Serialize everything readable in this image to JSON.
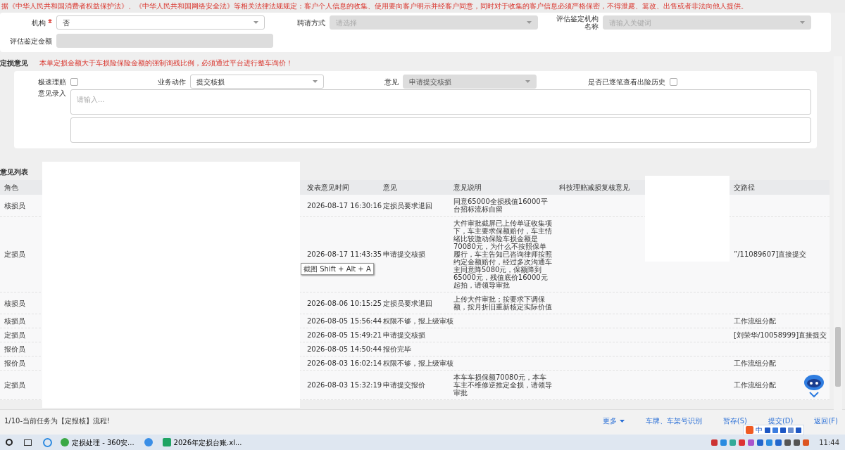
{
  "banner": "据《中华人民共和国消费者权益保护法》、《中华人民共和国网络安全法》等相关法律法规规定：客户个人信息的收集、使用要向客户明示并经客户同意，同时对于收集的客户信息必须严格保密，不得泄露、篡改、出售或者非法向他人提供。",
  "top_form": [
    {
      "kind": "select",
      "label": "机构",
      "required": true,
      "value": "否",
      "disabled": false
    },
    {
      "kind": "select",
      "label": "聘请方式",
      "required": false,
      "placeholder": "请选择",
      "disabled": true
    },
    {
      "kind": "select",
      "label": "评估鉴定机构名称",
      "required": false,
      "placeholder": "请输入关键词",
      "disabled": true
    },
    {
      "kind": "input",
      "label": "评估鉴定金额",
      "required": false,
      "disabled": true
    }
  ],
  "opinion": {
    "title": "定损意见",
    "warning": "本单定损金额大于车损险保险金额的强制询残比例，必须通过平台进行整车询价！",
    "fields": [
      {
        "kind": "checkbox",
        "label": "极速理赔",
        "checked": false
      },
      {
        "kind": "select",
        "label": "业务动作",
        "value": "提交核损",
        "disabled": false
      },
      {
        "kind": "select",
        "label": "意见",
        "value": "申请提交核损",
        "disabled": true
      },
      {
        "kind": "checkbox",
        "label": "是否已逐笔查看出险历史",
        "checked": false
      }
    ],
    "entry_label": "意见录入",
    "entry_placeholder": "请输入..."
  },
  "table": {
    "title": "意见列表",
    "columns": [
      "角色",
      "发表意见时间",
      "意见",
      "意见说明",
      "科技理赔减损复核意见",
      "交路径"
    ],
    "rows": [
      {
        "role": "核损员",
        "time": "2026-08-17 16:30:16",
        "opinion": "定损员要求退回",
        "note": "同意65000全损残值16000平台招标流标自留"
      },
      {
        "role": "定损员",
        "time": "2026-08-17 11:43:35",
        "opinion": "申请提交核损",
        "note": "大件审批截屏已上传单证收集项下，车主要求保额赔付，车主情绪比较激动保险车损金额是70080元，为什么不按照保单履行，车主告知已咨询律师按照约定金额赔付，经过多次沟通车主同意降5080元，保额降到65000元，残值底价16000元起拍，请领导审批",
        "route": "”/11089607]直接提交"
      },
      {
        "role": "核损员",
        "time": "2026-08-06 10:15:25",
        "opinion": "定损员要求退回",
        "note": "上传大件审批；按要求下调保额，按月折旧重新核定实际价值"
      },
      {
        "role": "核损员",
        "time": "2026-08-05 15:56:44",
        "opinion": "权限不够，报上级审核",
        "route": "工作流组分配"
      },
      {
        "role": "定损员",
        "time": "2026-08-05 15:49:21",
        "opinion": "申请提交核损",
        "route": "[刘荣华/10058999]直接提交"
      },
      {
        "role": "报价员",
        "time": "2026-08-05 14:50:44",
        "opinion": "报价完毕"
      },
      {
        "role": "报价员",
        "time": "2026-08-03 16:02:14",
        "opinion": "权限不够，报上级审核",
        "route": "工作流组分配"
      },
      {
        "role": "定损员",
        "time": "2026-08-03 15:32:19",
        "opinion": "申请提交报价",
        "note": "本车车损保额70080元，本车车主不维修逆推定全损，请领导审批",
        "route": "工作流组分配"
      }
    ]
  },
  "tooltip": "截图 Shift + Alt + A",
  "footer": {
    "status": "1/10-当前任务为【定报核】流程!",
    "buttons": [
      {
        "label": "更多",
        "kind": "menu"
      },
      {
        "label": "车牌、车架号识别",
        "kind": "link"
      },
      {
        "label": "暂存(S)",
        "kind": "link"
      },
      {
        "label": "提交(D)",
        "kind": "link"
      },
      {
        "label": "返回(F)",
        "kind": "link"
      }
    ]
  },
  "ime_bar": {
    "mode": "中"
  },
  "taskbar": {
    "apps": [
      {
        "kind": "app",
        "label": "定损处理 - 360安..."
      },
      {
        "kind": "icon"
      },
      {
        "kind": "app",
        "label": "2026年定损台账.xl..."
      }
    ],
    "time": "11:44"
  }
}
